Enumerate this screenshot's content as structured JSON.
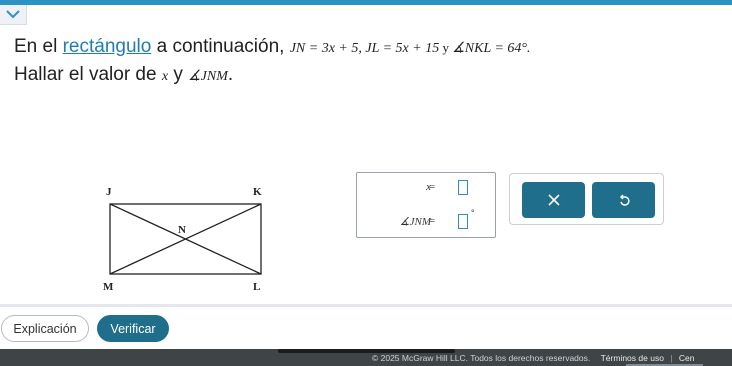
{
  "question": {
    "prefix": "En el ",
    "link": "rectángulo",
    "middle": " a continuación, ",
    "given": "JN = 3x + 5, JL = 5x + 15",
    "and": " y ",
    "angle_given": "∡NKL = 64°.",
    "line2_prefix": "Hallar el valor de ",
    "var_x": "x",
    "line2_and": " y ",
    "angle_find": "∡JNM",
    "period": "."
  },
  "diagram": {
    "label_J": "J",
    "label_K": "K",
    "label_N": "N",
    "label_M": "M",
    "label_L": "L"
  },
  "answers": {
    "row1_label": "x",
    "row2_label": "∡JNM",
    "equals": "=",
    "degree": "°"
  },
  "tools": {
    "clear_icon": "x-icon",
    "undo_icon": "undo-icon"
  },
  "buttons": {
    "explanation": "Explicación",
    "verify": "Verificar"
  },
  "footer": {
    "copyright": "© 2025 McGraw Hill LLC. Todos los derechos reservados.",
    "terms": "Términos de uso",
    "separator": "|",
    "next": "Cen"
  },
  "colors": {
    "accent": "#2b93c4",
    "button": "#1f6e8c",
    "link": "#1f7eb0",
    "footer": "#3f4447"
  }
}
